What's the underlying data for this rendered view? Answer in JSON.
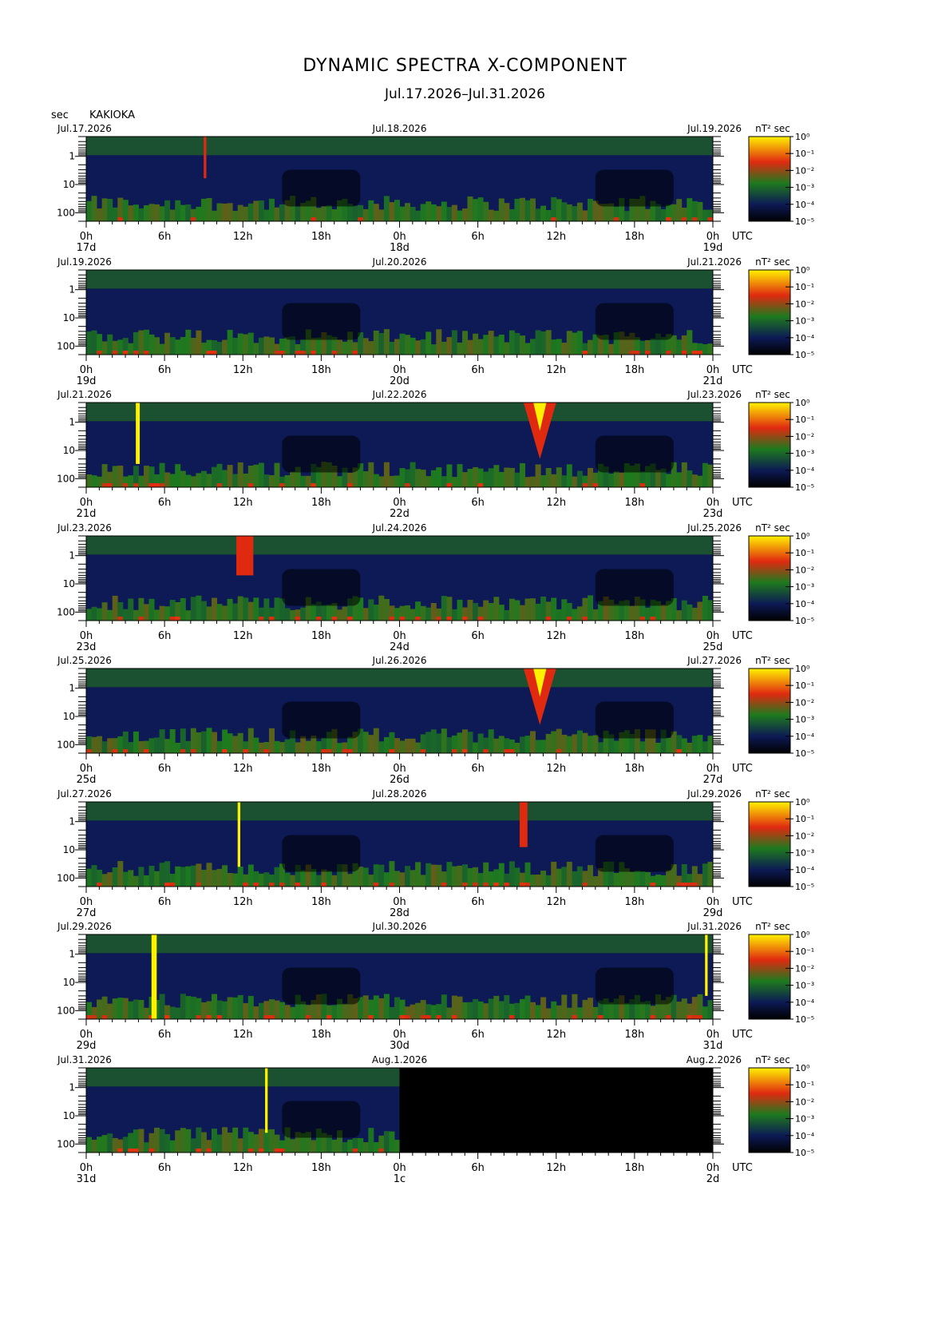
{
  "header": {
    "title": "DYNAMIC SPECTRA X-COMPONENT",
    "period": "Jul.17.2026–Jul.31.2026",
    "y_unit": "sec",
    "station": "KAKIOKA",
    "colorbar_unit": "nT² sec",
    "x_unit": "UTC"
  },
  "colors": {
    "background": "#000000",
    "dark_blue": "#0d1a55",
    "green": "#1e7a1e",
    "red": "#e02a10",
    "yellow": "#fff200"
  },
  "chart_data": [
    {
      "type": "heatmap",
      "date_left": "Jul.17.2026",
      "date_mid": "Jul.18.2026",
      "date_right": "Jul.19.2026",
      "x_tick_labels": [
        "0h",
        "6h",
        "12h",
        "18h",
        "0h",
        "6h",
        "12h",
        "18h",
        "0h"
      ],
      "day_labels": [
        "17d",
        "18d",
        "19d"
      ],
      "y_tick_labels": [
        "1",
        "10",
        "100"
      ],
      "ylim": [
        0.2,
        200
      ],
      "yscale": "log",
      "colorbar_ticks": [
        "10⁰",
        "10⁻¹",
        "10⁻²",
        "10⁻³",
        "10⁻⁴",
        "10⁻⁵"
      ],
      "colorbar_range": [
        1e-05,
        1
      ],
      "no_data_from_hours": null,
      "events": [
        {
          "start_hour": 9.0,
          "end_hour": 9.2,
          "top_period": 0.2,
          "bottom_period": 6,
          "level": "red"
        }
      ]
    },
    {
      "type": "heatmap",
      "date_left": "Jul.19.2026",
      "date_mid": "Jul.20.2026",
      "date_right": "Jul.21.2026",
      "x_tick_labels": [
        "0h",
        "6h",
        "12h",
        "18h",
        "0h",
        "6h",
        "12h",
        "18h",
        "0h"
      ],
      "day_labels": [
        "19d",
        "20d",
        "21d"
      ],
      "y_tick_labels": [
        "1",
        "10",
        "100"
      ],
      "ylim": [
        0.2,
        200
      ],
      "yscale": "log",
      "colorbar_ticks": [
        "10⁰",
        "10⁻¹",
        "10⁻²",
        "10⁻³",
        "10⁻⁴",
        "10⁻⁵"
      ],
      "colorbar_range": [
        1e-05,
        1
      ],
      "no_data_from_hours": null,
      "events": []
    },
    {
      "type": "heatmap",
      "date_left": "Jul.21.2026",
      "date_mid": "Jul.22.2026",
      "date_right": "Jul.23.2026",
      "x_tick_labels": [
        "0h",
        "6h",
        "12h",
        "18h",
        "0h",
        "6h",
        "12h",
        "18h",
        "0h"
      ],
      "day_labels": [
        "21d",
        "22d",
        "23d"
      ],
      "y_tick_labels": [
        "1",
        "10",
        "100"
      ],
      "ylim": [
        0.2,
        200
      ],
      "yscale": "log",
      "colorbar_ticks": [
        "10⁰",
        "10⁻¹",
        "10⁻²",
        "10⁻³",
        "10⁻⁴",
        "10⁻⁵"
      ],
      "colorbar_range": [
        1e-05,
        1
      ],
      "no_data_from_hours": null,
      "events": [
        {
          "start_hour": 3.8,
          "end_hour": 4.1,
          "top_period": 0.2,
          "bottom_period": 30,
          "level": "yellow"
        },
        {
          "start_hour": 33.5,
          "end_hour": 36.0,
          "top_period": 0.2,
          "bottom_period": 20,
          "level": "yellow-red"
        }
      ]
    },
    {
      "type": "heatmap",
      "date_left": "Jul.23.2026",
      "date_mid": "Jul.24.2026",
      "date_right": "Jul.25.2026",
      "x_tick_labels": [
        "0h",
        "6h",
        "12h",
        "18h",
        "0h",
        "6h",
        "12h",
        "18h",
        "0h"
      ],
      "day_labels": [
        "23d",
        "24d",
        "25d"
      ],
      "y_tick_labels": [
        "1",
        "10",
        "100"
      ],
      "ylim": [
        0.2,
        200
      ],
      "yscale": "log",
      "colorbar_ticks": [
        "10⁰",
        "10⁻¹",
        "10⁻²",
        "10⁻³",
        "10⁻⁴",
        "10⁻⁵"
      ],
      "colorbar_range": [
        1e-05,
        1
      ],
      "no_data_from_hours": null,
      "events": [
        {
          "start_hour": 11.5,
          "end_hour": 12.8,
          "top_period": 0.2,
          "bottom_period": 5,
          "level": "red"
        }
      ]
    },
    {
      "type": "heatmap",
      "date_left": "Jul.25.2026",
      "date_mid": "Jul.26.2026",
      "date_right": "Jul.27.2026",
      "x_tick_labels": [
        "0h",
        "6h",
        "12h",
        "18h",
        "0h",
        "6h",
        "12h",
        "18h",
        "0h"
      ],
      "day_labels": [
        "25d",
        "26d",
        "27d"
      ],
      "y_tick_labels": [
        "1",
        "10",
        "100"
      ],
      "ylim": [
        0.2,
        200
      ],
      "yscale": "log",
      "colorbar_ticks": [
        "10⁰",
        "10⁻¹",
        "10⁻²",
        "10⁻³",
        "10⁻⁴",
        "10⁻⁵"
      ],
      "colorbar_range": [
        1e-05,
        1
      ],
      "no_data_from_hours": null,
      "events": [
        {
          "start_hour": 33.5,
          "end_hour": 36.0,
          "top_period": 0.2,
          "bottom_period": 20,
          "level": "yellow-red"
        }
      ]
    },
    {
      "type": "heatmap",
      "date_left": "Jul.27.2026",
      "date_mid": "Jul.28.2026",
      "date_right": "Jul.29.2026",
      "x_tick_labels": [
        "0h",
        "6h",
        "12h",
        "18h",
        "0h",
        "6h",
        "12h",
        "18h",
        "0h"
      ],
      "day_labels": [
        "27d",
        "28d",
        "29d"
      ],
      "y_tick_labels": [
        "1",
        "10",
        "100"
      ],
      "ylim": [
        0.2,
        200
      ],
      "yscale": "log",
      "colorbar_ticks": [
        "10⁰",
        "10⁻¹",
        "10⁻²",
        "10⁻³",
        "10⁻⁴",
        "10⁻⁵"
      ],
      "colorbar_range": [
        1e-05,
        1
      ],
      "no_data_from_hours": null,
      "events": [
        {
          "start_hour": 11.6,
          "end_hour": 11.8,
          "top_period": 0.2,
          "bottom_period": 40,
          "level": "yellow"
        },
        {
          "start_hour": 33.2,
          "end_hour": 33.8,
          "top_period": 0.2,
          "bottom_period": 8,
          "level": "red"
        }
      ]
    },
    {
      "type": "heatmap",
      "date_left": "Jul.29.2026",
      "date_mid": "Jul.30.2026",
      "date_right": "Jul.31.2026",
      "x_tick_labels": [
        "0h",
        "6h",
        "12h",
        "18h",
        "0h",
        "6h",
        "12h",
        "18h",
        "0h"
      ],
      "day_labels": [
        "29d",
        "30d",
        "31d"
      ],
      "y_tick_labels": [
        "1",
        "10",
        "100"
      ],
      "ylim": [
        0.2,
        200
      ],
      "yscale": "log",
      "colorbar_ticks": [
        "10⁰",
        "10⁻¹",
        "10⁻²",
        "10⁻³",
        "10⁻⁴",
        "10⁻⁵"
      ],
      "colorbar_range": [
        1e-05,
        1
      ],
      "no_data_from_hours": null,
      "events": [
        {
          "start_hour": 5.0,
          "end_hour": 5.4,
          "top_period": 0.2,
          "bottom_period": 200,
          "level": "yellow"
        },
        {
          "start_hour": 47.4,
          "end_hour": 47.6,
          "top_period": 0.2,
          "bottom_period": 30,
          "level": "yellow"
        }
      ]
    },
    {
      "type": "heatmap",
      "date_left": "Jul.31.2026",
      "date_mid": "Aug.1.2026",
      "date_right": "Aug.2.2026",
      "x_tick_labels": [
        "0h",
        "6h",
        "12h",
        "18h",
        "0h",
        "6h",
        "12h",
        "18h",
        "0h"
      ],
      "day_labels": [
        "31d",
        "1c",
        "2d"
      ],
      "y_tick_labels": [
        "1",
        "10",
        "100"
      ],
      "ylim": [
        0.2,
        200
      ],
      "yscale": "log",
      "colorbar_ticks": [
        "10⁰",
        "10⁻¹",
        "10⁻²",
        "10⁻³",
        "10⁻⁴",
        "10⁻⁵"
      ],
      "colorbar_range": [
        1e-05,
        1
      ],
      "no_data_from_hours": 24,
      "events": [
        {
          "start_hour": 13.7,
          "end_hour": 13.9,
          "top_period": 0.2,
          "bottom_period": 40,
          "level": "yellow"
        }
      ]
    }
  ]
}
